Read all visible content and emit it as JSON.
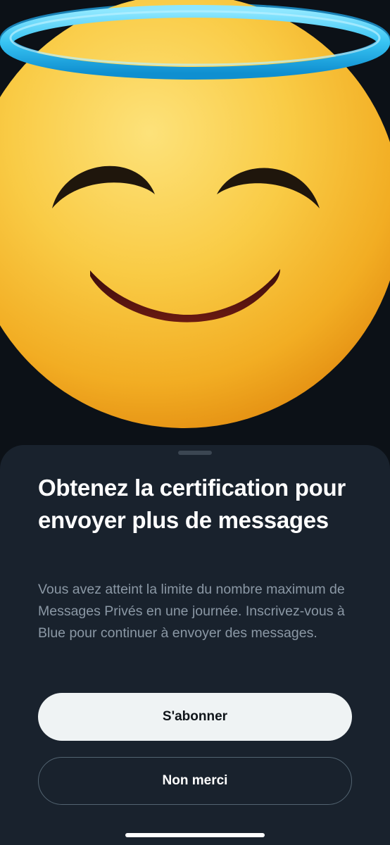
{
  "hero": {
    "emoji_icon": "smiling-face-with-halo-icon"
  },
  "sheet": {
    "title": "Obtenez la certification pour envoyer plus de messages",
    "description": "Vous avez atteint la limite du nombre maximum de Messages Privés en une journée. Inscrivez-vous à Blue pour continuer à envoyer des messages.",
    "subscribe_label": "S'abonner",
    "decline_label": "Non merci"
  },
  "colors": {
    "sheet_background": "#19222d",
    "primary_button": "#eff3f4",
    "halo": "#3ac8f5",
    "emoji_face": "#f7c23a"
  }
}
